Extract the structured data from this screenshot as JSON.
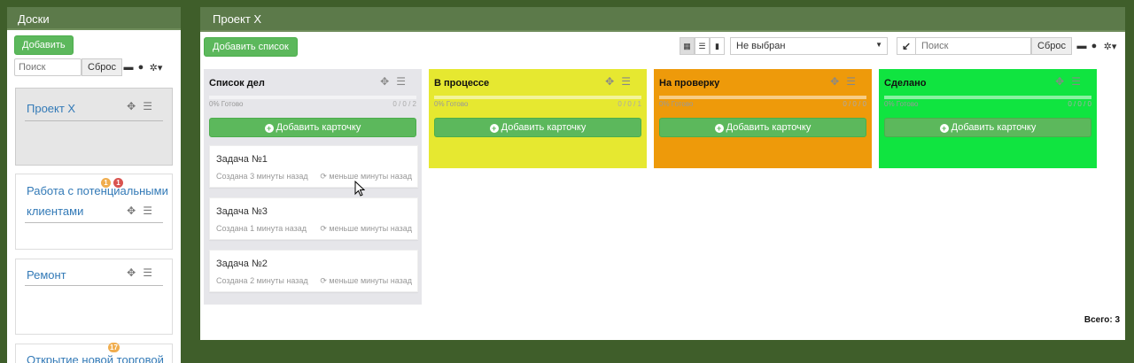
{
  "sidebar": {
    "title": "Доски",
    "add_label": "Добавить",
    "search_placeholder": "Поиск",
    "reset_label": "Сброс",
    "boards": [
      {
        "title": "Проект X",
        "active": true,
        "badges": []
      },
      {
        "title": "Работа с потенциальными клиентами",
        "active": false,
        "badges": [
          {
            "value": "1",
            "color": "#f0ad4e"
          },
          {
            "value": "1",
            "color": "#d9534f"
          }
        ]
      },
      {
        "title": "Ремонт",
        "active": false,
        "badges": []
      },
      {
        "title": "Открытие новой торговой",
        "active": false,
        "badges": [
          {
            "value": "17",
            "color": "#f0ad4e"
          }
        ]
      }
    ]
  },
  "board": {
    "title": "Проект X",
    "add_list_label": "Добавить список",
    "select_value": "Не выбран",
    "search_placeholder": "Поиск",
    "reset_label": "Сброс",
    "total_label": "Всего: 3",
    "add_card_label": "Добавить карточку",
    "lists": [
      {
        "title": "Список дел",
        "color": "#e6e6ea",
        "progress_label": "0% Готово",
        "count": "0 / 0 / 2",
        "progress": 0,
        "tasks": [
          {
            "title": "Задача №1",
            "created": "Создана 3 минуты назад",
            "updated": "меньше минуты назад"
          },
          {
            "title": "Задача №3",
            "created": "Создана 1 минута назад",
            "updated": "меньше минуты назад"
          },
          {
            "title": "Задача №2",
            "created": "Создана 2 минуты назад",
            "updated": "меньше минуты назад"
          }
        ]
      },
      {
        "title": "В процессе",
        "color": "#e6e830",
        "progress_label": "0% Готово",
        "count": "0 / 0 / 1",
        "progress": 0,
        "tasks": []
      },
      {
        "title": "На проверку",
        "color": "#ee9a0a",
        "progress_label": "0% Готово",
        "count": "0 / 0 / 0",
        "progress": 0,
        "tasks": []
      },
      {
        "title": "Сделано",
        "color": "#10e440",
        "progress_label": "0% Готово",
        "count": "0 / 0 / 0",
        "progress": 0,
        "tasks": []
      }
    ]
  },
  "icons": {
    "print": "print-icon",
    "info": "info-icon",
    "settings": "gear-icon",
    "move": "move-icon",
    "edit": "sliders-icon",
    "refresh": "refresh-icon"
  }
}
